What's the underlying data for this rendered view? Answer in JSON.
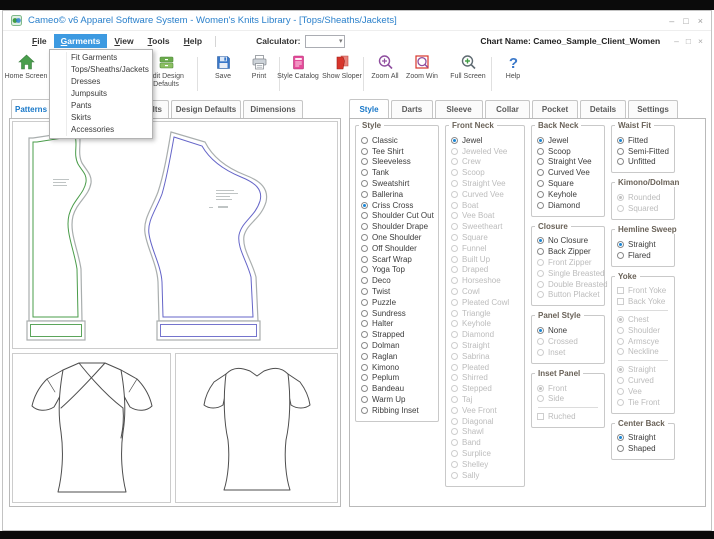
{
  "window": {
    "title": "Cameo© v6 Apparel Software System - Women's Knits Library - [Tops/Sheaths/Jackets]",
    "controls": {
      "minimize": "–",
      "maximize": "□",
      "close": "×"
    },
    "child_controls": {
      "minimize": "–",
      "restore": "□",
      "close": "×"
    }
  },
  "menu_bar": {
    "items": [
      "File",
      "Garments",
      "View",
      "Tools",
      "Help"
    ],
    "calculator_label": "Calculator:",
    "chart_name_label": "Chart Name:",
    "chart_name_value": "Cameo_Sample_Client_Women"
  },
  "garments_menu": {
    "items": [
      "Fit Garments",
      "Tops/Sheaths/Jackets",
      "Dresses",
      "Jumpsuits",
      "Pants",
      "Skirts",
      "Accessories"
    ]
  },
  "toolbar": {
    "buttons": [
      {
        "label": "Home Screen",
        "icon": "home-icon"
      },
      {
        "label": "Edit Design Defaults",
        "icon": "edit-design-defaults-icon"
      },
      {
        "label": "Save",
        "icon": "save-icon"
      },
      {
        "label": "Print",
        "icon": "print-icon"
      },
      {
        "label": "Style Catalog",
        "icon": "style-catalog-icon"
      },
      {
        "label": "Show Sloper",
        "icon": "show-sloper-icon"
      },
      {
        "label": "Zoom All",
        "icon": "zoom-all-icon"
      },
      {
        "label": "Zoom Win",
        "icon": "zoom-win-icon"
      },
      {
        "label": "Full Screen",
        "icon": "full-screen-icon"
      },
      {
        "label": "Help",
        "icon": "help-icon"
      }
    ]
  },
  "pattern_panel": {
    "tabs": [
      {
        "label": "Patterns",
        "selected": true
      },
      {
        "label": "Defaults",
        "selected": false
      },
      {
        "label": "Design Defaults",
        "selected": false
      },
      {
        "label": "Dimensions",
        "selected": false
      }
    ]
  },
  "style_panel": {
    "tabs": [
      {
        "label": "Style",
        "selected": true
      },
      {
        "label": "Darts",
        "selected": false
      },
      {
        "label": "Sleeve",
        "selected": false
      },
      {
        "label": "Collar",
        "selected": false
      },
      {
        "label": "Pocket",
        "selected": false
      },
      {
        "label": "Details",
        "selected": false
      },
      {
        "label": "Settings",
        "selected": false
      }
    ],
    "columns": [
      [
        "style"
      ],
      [
        "front_neck"
      ],
      [
        "back_neck",
        "closure",
        "panel_style",
        "inset_panel"
      ],
      [
        "waist_fit",
        "kimono_dolman",
        "hemline_sweep",
        "yoke",
        "center_back"
      ]
    ],
    "groups": {
      "style": {
        "title": "Style",
        "items": [
          {
            "label": "Classic"
          },
          {
            "label": "Tee Shirt"
          },
          {
            "label": "Sleeveless"
          },
          {
            "label": "Tank"
          },
          {
            "label": "Sweatshirt"
          },
          {
            "label": "Ballerina"
          },
          {
            "label": "Criss Cross",
            "selected": true
          },
          {
            "label": "Shoulder Cut Out"
          },
          {
            "label": "Shoulder Drape"
          },
          {
            "label": "One Shoulder"
          },
          {
            "label": "Off Shoulder"
          },
          {
            "label": "Scarf Wrap"
          },
          {
            "label": "Yoga Top"
          },
          {
            "label": "Deco"
          },
          {
            "label": "Twist"
          },
          {
            "label": "Puzzle"
          },
          {
            "label": "Sundress"
          },
          {
            "label": "Halter"
          },
          {
            "label": "Strapped"
          },
          {
            "label": "Dolman"
          },
          {
            "label": "Raglan"
          },
          {
            "label": "Kimono"
          },
          {
            "label": "Peplum"
          },
          {
            "label": "Bandeau"
          },
          {
            "label": "Warm Up"
          },
          {
            "label": "Ribbing Inset"
          }
        ]
      },
      "front_neck": {
        "title": "Front Neck",
        "items": [
          {
            "label": "Jewel",
            "selected": true
          },
          {
            "label": "Jeweled Vee",
            "disabled": true
          },
          {
            "label": "Crew",
            "disabled": true
          },
          {
            "label": "Scoop",
            "disabled": true
          },
          {
            "label": "Straight Vee",
            "disabled": true
          },
          {
            "label": "Curved Vee",
            "disabled": true
          },
          {
            "label": "Boat",
            "disabled": true
          },
          {
            "label": "Vee Boat",
            "disabled": true
          },
          {
            "label": "Sweetheart",
            "disabled": true
          },
          {
            "label": "Square",
            "disabled": true
          },
          {
            "label": "Funnel",
            "disabled": true
          },
          {
            "label": "Built Up",
            "disabled": true
          },
          {
            "label": "Draped",
            "disabled": true
          },
          {
            "label": "Horseshoe",
            "disabled": true
          },
          {
            "label": "Cowl",
            "disabled": true
          },
          {
            "label": "Pleated Cowl",
            "disabled": true
          },
          {
            "label": "Triangle",
            "disabled": true
          },
          {
            "label": "Keyhole",
            "disabled": true
          },
          {
            "label": "Diamond",
            "disabled": true
          },
          {
            "label": "Straight",
            "disabled": true
          },
          {
            "label": "Sabrina",
            "disabled": true
          },
          {
            "label": "Pleated",
            "disabled": true
          },
          {
            "label": "Shirred",
            "disabled": true
          },
          {
            "label": "Stepped",
            "disabled": true
          },
          {
            "label": "Taj",
            "disabled": true
          },
          {
            "label": "Vee Front",
            "disabled": true
          },
          {
            "label": "Diagonal",
            "disabled": true
          },
          {
            "label": "Shawl",
            "disabled": true
          },
          {
            "label": "Band",
            "disabled": true
          },
          {
            "label": "Surplice",
            "disabled": true
          },
          {
            "label": "Shelley",
            "disabled": true
          },
          {
            "label": "Sally",
            "disabled": true
          }
        ]
      },
      "back_neck": {
        "title": "Back Neck",
        "items": [
          {
            "label": "Jewel",
            "selected": true
          },
          {
            "label": "Scoop"
          },
          {
            "label": "Straight Vee"
          },
          {
            "label": "Curved Vee"
          },
          {
            "label": "Square"
          },
          {
            "label": "Keyhole"
          },
          {
            "label": "Diamond"
          }
        ]
      },
      "closure": {
        "title": "Closure",
        "items": [
          {
            "label": "No Closure",
            "selected": true
          },
          {
            "label": "Back Zipper"
          },
          {
            "label": "Front Zipper",
            "disabled": true
          },
          {
            "label": "Single Breasted",
            "disabled": true
          },
          {
            "label": "Double Breasted",
            "disabled": true
          },
          {
            "label": "Button Placket",
            "disabled": true
          }
        ]
      },
      "panel_style": {
        "title": "Panel Style",
        "items": [
          {
            "label": "None",
            "selected": true
          },
          {
            "label": "Crossed",
            "disabled": true
          },
          {
            "label": "Inset",
            "disabled": true
          }
        ]
      },
      "inset_panel": {
        "title": "Inset Panel",
        "items": [
          {
            "label": "Front",
            "selected": true,
            "disabled": true
          },
          {
            "label": "Side",
            "disabled": true
          },
          {
            "type": "separator"
          },
          {
            "label": "Ruched",
            "type": "checkbox",
            "disabled": true
          }
        ]
      },
      "waist_fit": {
        "title": "Waist Fit",
        "items": [
          {
            "label": "Fitted",
            "selected": true
          },
          {
            "label": "Semi-Fitted"
          },
          {
            "label": "Unfitted"
          }
        ]
      },
      "kimono_dolman": {
        "title": "Kimono/Dolman",
        "items": [
          {
            "label": "Rounded",
            "selected": true,
            "disabled": true
          },
          {
            "label": "Squared",
            "disabled": true
          }
        ]
      },
      "hemline_sweep": {
        "title": "Hemline Sweep",
        "items": [
          {
            "label": "Straight",
            "selected": true
          },
          {
            "label": "Flared"
          }
        ]
      },
      "yoke": {
        "title": "Yoke",
        "items": [
          {
            "label": "Front Yoke",
            "type": "checkbox",
            "disabled": true
          },
          {
            "label": "Back Yoke",
            "type": "checkbox",
            "disabled": true
          },
          {
            "type": "separator"
          },
          {
            "label": "Chest",
            "selected": true,
            "disabled": true
          },
          {
            "label": "Shoulder",
            "disabled": true
          },
          {
            "label": "Armscye",
            "disabled": true
          },
          {
            "label": "Neckline",
            "disabled": true
          },
          {
            "type": "separator"
          },
          {
            "label": "Straight",
            "selected": true,
            "disabled": true
          },
          {
            "label": "Curved",
            "disabled": true
          },
          {
            "label": "Vee",
            "disabled": true
          },
          {
            "label": "Tie Front",
            "disabled": true
          }
        ]
      },
      "center_back": {
        "title": "Center Back",
        "items": [
          {
            "label": "Straight",
            "selected": true
          },
          {
            "label": "Shaped"
          }
        ]
      }
    }
  }
}
